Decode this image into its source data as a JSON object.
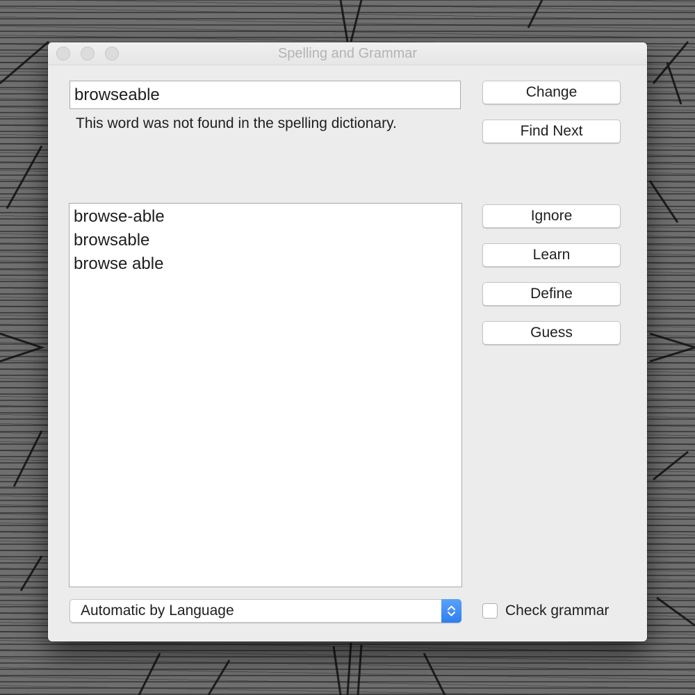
{
  "window": {
    "title": "Spelling and Grammar"
  },
  "misspelled_word": "browseable",
  "status_message": "This word was not found in the spelling dictionary.",
  "buttons": {
    "change": "Change",
    "find_next": "Find Next",
    "ignore": "Ignore",
    "learn": "Learn",
    "define": "Define",
    "guess": "Guess"
  },
  "suggestions": [
    "browse-able",
    "browsable",
    "browse able"
  ],
  "language_select": {
    "value": "Automatic by Language"
  },
  "check_grammar": {
    "label": "Check grammar",
    "checked": false
  },
  "icons": {
    "window_controls": [
      "close-icon",
      "minimize-icon",
      "zoom-icon"
    ],
    "select_stepper": "chevron-up-down-icon"
  },
  "colors": {
    "accent": "#3b86f5",
    "window_bg": "#ececec",
    "desktop_bg": "#6f6f6f"
  }
}
